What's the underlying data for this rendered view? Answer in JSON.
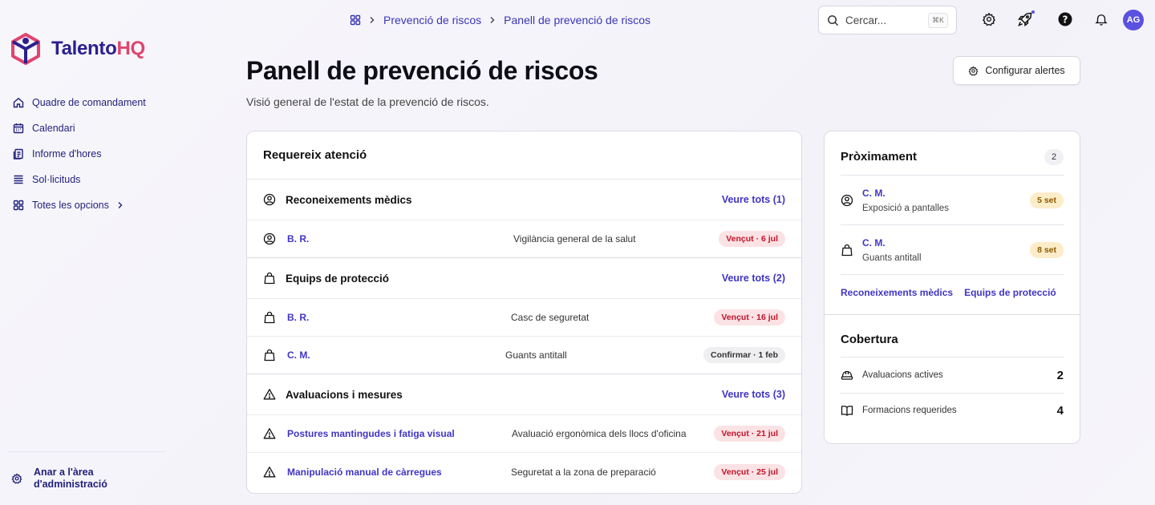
{
  "brand": {
    "name_main": "Talento",
    "name_accent": "HQ",
    "accent_color": "#e0446f",
    "primary_color": "#2b1f8f"
  },
  "sidebar": {
    "items": [
      {
        "label": "Quadre de comandament",
        "icon": "home-icon"
      },
      {
        "label": "Calendari",
        "icon": "calendar-icon"
      },
      {
        "label": "Informe d'hores",
        "icon": "report-icon"
      },
      {
        "label": "Sol·licituds",
        "icon": "list-icon"
      }
    ],
    "all_options": "Totes les opcions",
    "admin_link": "Anar a l'àrea d'administració"
  },
  "topbar": {
    "breadcrumb": [
      "Prevenció de riscos",
      "Panell de prevenció de riscos"
    ],
    "search_placeholder": "Cercar...",
    "search_shortcut": "⌘K",
    "avatar_initials": "AG"
  },
  "page": {
    "title": "Panell de prevenció de riscos",
    "subtitle": "Visió general de l'estat de la prevenció de riscos.",
    "config_button": "Configurar alertes"
  },
  "attention": {
    "title": "Requereix atenció",
    "groups": [
      {
        "title": "Reconeixements mèdics",
        "view_all": "Veure tots (1)",
        "icon": "user-circle-icon",
        "rows": [
          {
            "who": "B. R.",
            "desc": "Vigilància general de la salut",
            "badge": "Vençut · 6 jul",
            "status": "red"
          }
        ]
      },
      {
        "title": "Equips de protecció",
        "view_all": "Veure tots (2)",
        "icon": "bag-icon",
        "rows": [
          {
            "who": "B. R.",
            "desc": "Casc de seguretat",
            "badge": "Vençut · 16 jul",
            "status": "red"
          },
          {
            "who": "C. M.",
            "desc": "Guants antitall",
            "badge": "Confirmar · 1 feb",
            "status": "gray"
          }
        ]
      },
      {
        "title": "Avaluacions i mesures",
        "view_all": "Veure tots (3)",
        "icon": "warning-icon",
        "rows": [
          {
            "who": "Postures mantingudes i fatiga visual",
            "desc": "Avaluació ergonòmica dels llocs d'oficina",
            "badge": "Vençut · 21 jul",
            "status": "red"
          },
          {
            "who": "Manipulació manual de càrregues",
            "desc": "Seguretat a la zona de preparació",
            "badge": "Vençut · 25 jul",
            "status": "red"
          }
        ]
      }
    ]
  },
  "upcoming": {
    "title": "Pròximament",
    "count": "2",
    "items": [
      {
        "who": "C. M.",
        "sub": "Exposició a pantalles",
        "badge": "5 set",
        "icon": "user-circle-icon"
      },
      {
        "who": "C. M.",
        "sub": "Guants antitall",
        "badge": "8 set",
        "icon": "bag-icon"
      }
    ],
    "links": [
      "Reconeixements mèdics",
      "Equips de protecció"
    ]
  },
  "coverage": {
    "title": "Cobertura",
    "rows": [
      {
        "label": "Avaluacions actives",
        "value": "2",
        "icon": "helmet-icon"
      },
      {
        "label": "Formacions requerides",
        "value": "4",
        "icon": "book-icon"
      }
    ]
  }
}
